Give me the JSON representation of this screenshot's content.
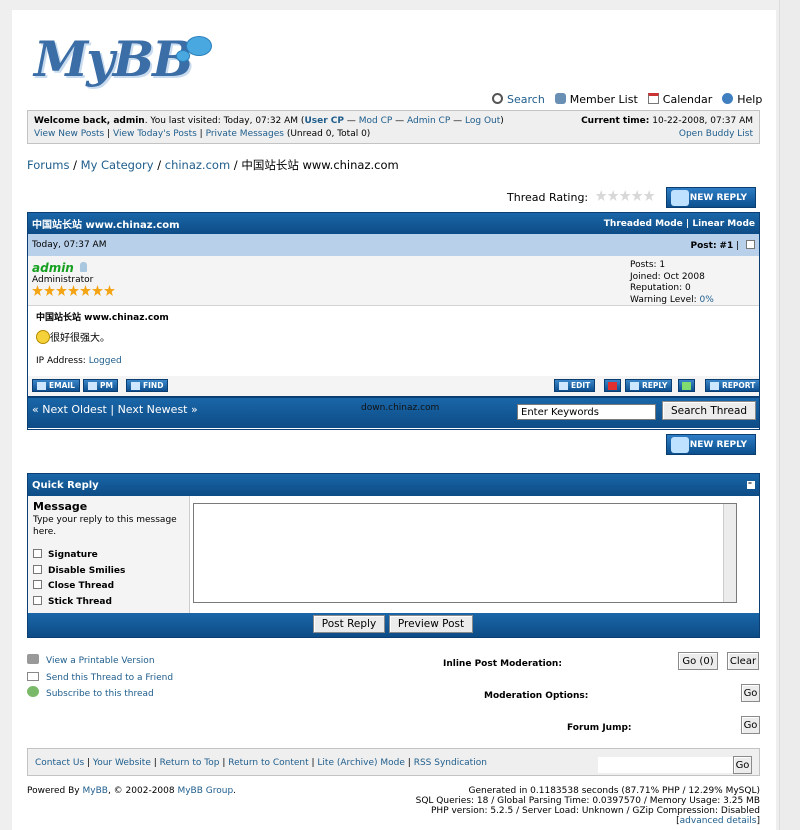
{
  "logo": {
    "text": "MyBB"
  },
  "toplinks": [
    {
      "label": "Search",
      "icon": "search-icon"
    },
    {
      "label": "Member List",
      "icon": "members-icon"
    },
    {
      "label": "Calendar",
      "icon": "calendar-icon"
    },
    {
      "label": "Help",
      "icon": "help-icon"
    }
  ],
  "welcome": {
    "prefix": "Welcome back, admin",
    "visited": ". You last visited: Today, 07:32 AM (",
    "usercp": "User CP",
    "sep": " — ",
    "modcp": "Mod CP",
    "admincp": "Admin CP",
    "logout": "Log Out",
    "close": ")",
    "newposts": "View New Posts",
    "todays": "View Today's Posts",
    "pm": "Private Messages",
    "pmcount": "(Unread 0, Total 0)",
    "time_label": "Current time:",
    "time": "10-22-2008, 07:37 AM",
    "buddy": "Open Buddy List"
  },
  "breadcrumb": {
    "forums": "Forums",
    "cat": "My Category",
    "forum": "chinaz.com",
    "current": "中国站长站  www.chinaz.com",
    "sep": " / "
  },
  "rating_label": "Thread Rating:",
  "new_reply": "NEW REPLY",
  "thread": {
    "title": "中国站长站  www.chinaz.com",
    "threaded": "Threaded Mode",
    "linear": "Linear Mode",
    "date": "Today, 07:37 AM",
    "post_label": "Post:",
    "post_no": "#1"
  },
  "author": {
    "name": "admin",
    "title": "Administrator",
    "posts": "Posts: 1",
    "joined": "Joined: Oct 2008",
    "rep": "Reputation: 0",
    "warn_label": "Warning Level: ",
    "warn": "0%"
  },
  "post": {
    "subject": "中国站长站  www.chinaz.com",
    "body": "很好很强大。",
    "ip_label": "IP Address: ",
    "ip": "Logged"
  },
  "postbtns": {
    "email": "EMAIL",
    "pm": "PM",
    "find": "FIND",
    "edit": "EDIT",
    "reply": "REPLY",
    "report": "REPORT"
  },
  "nav": {
    "oldest": "« Next Oldest",
    "newest": "Next Newest »",
    "center": "down.chinaz.com",
    "search_placeholder": "Enter Keywords",
    "search_btn": "Search Thread"
  },
  "quick": {
    "title": "Quick Reply",
    "collapse": "–",
    "message": "Message",
    "hint": "Type your reply to this message here.",
    "options": [
      "Signature",
      "Disable Smilies",
      "Close Thread",
      "Stick Thread"
    ],
    "post": "Post Reply",
    "preview": "Preview Post"
  },
  "tools": [
    {
      "label": "View a Printable Version",
      "icon": "printer-icon"
    },
    {
      "label": "Send this Thread to a Friend",
      "icon": "mail-icon"
    },
    {
      "label": "Subscribe to this thread",
      "icon": "subscribe-icon"
    }
  ],
  "mod": {
    "inline": "Inline Post Moderation:",
    "go0": "Go (0)",
    "clear": "Clear",
    "options": "Moderation Options:",
    "go": "Go",
    "jump": "Forum Jump:"
  },
  "footer": {
    "links": [
      "Contact Us",
      "Your Website",
      "Return to Top",
      "Return to Content",
      "Lite (Archive) Mode",
      "RSS Syndication"
    ],
    "go": "Go"
  },
  "powered": {
    "prefix": "Powered By ",
    "mybb": "MyBB",
    "mid": ", © 2002-2008 ",
    "group": "MyBB Group",
    "end": "."
  },
  "stats": {
    "l1": "Generated in 0.1183538 seconds (87.71% PHP / 12.29% MySQL)",
    "l2": "SQL Queries: 18 / Global Parsing Time: 0.0397570 / Memory Usage: 3.25 MB",
    "l3": "PHP version: 5.2.5 / Server Load: Unknown / GZip Compression: Disabled",
    "adv": "advanced details"
  }
}
